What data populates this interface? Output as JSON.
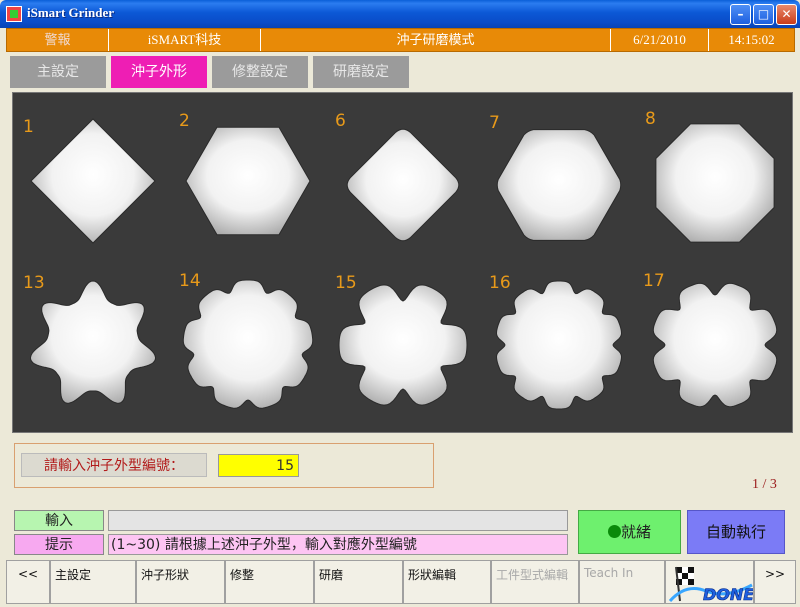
{
  "window": {
    "title": "iSmart Grinder",
    "min_label": "–",
    "max_label": "□",
    "close_label": "✕"
  },
  "status": {
    "alarm": "警報",
    "company": "iSMART科技",
    "mode": "沖子研磨模式",
    "date": "6/21/2010",
    "time": "14:15:02"
  },
  "tabs": [
    {
      "label": "主設定"
    },
    {
      "label": "沖子外形"
    },
    {
      "label": "修整設定"
    },
    {
      "label": "研磨設定"
    }
  ],
  "shapes": [
    {
      "number": "1",
      "kind": "diamond"
    },
    {
      "number": "2",
      "kind": "hexagon-flat"
    },
    {
      "number": "6",
      "kind": "diamond-notched"
    },
    {
      "number": "7",
      "kind": "hexagon-notched"
    },
    {
      "number": "8",
      "kind": "octagon"
    },
    {
      "number": "13",
      "kind": "star-7"
    },
    {
      "number": "14",
      "kind": "gear-9"
    },
    {
      "number": "15",
      "kind": "flower-6"
    },
    {
      "number": "16",
      "kind": "gear-10"
    },
    {
      "number": "17",
      "kind": "gear-8"
    }
  ],
  "input_section": {
    "label": "請輸入沖子外型編號：",
    "value": "15"
  },
  "page_indicator": "1 / 3",
  "messages": {
    "input_label": "輸入",
    "input_value": "",
    "hint_label": "提示",
    "hint_value": "(1~30) 請根據上述沖子外型，輸入對應外型編號"
  },
  "buttons": {
    "ready": "就緒",
    "auto_run": "自動執行",
    "done": "DONE"
  },
  "colors": {
    "accent_magenta": "#ee1eb4",
    "status_orange": "#e88a07",
    "number_orange": "#e89a1a",
    "ready_green": "#6ef06e",
    "auto_blue": "#7b7bf6"
  },
  "nav": [
    {
      "label": "<<",
      "enabled": true
    },
    {
      "label": "主設定",
      "enabled": true
    },
    {
      "label": "沖子形狀",
      "enabled": true
    },
    {
      "label": "修整",
      "enabled": true
    },
    {
      "label": "研磨",
      "enabled": true
    },
    {
      "label": "形狀編輯",
      "enabled": true
    },
    {
      "label": "工件型式編輯",
      "enabled": false
    },
    {
      "label": "Teach In",
      "enabled": false
    },
    {
      "label": ">>",
      "enabled": true
    }
  ]
}
